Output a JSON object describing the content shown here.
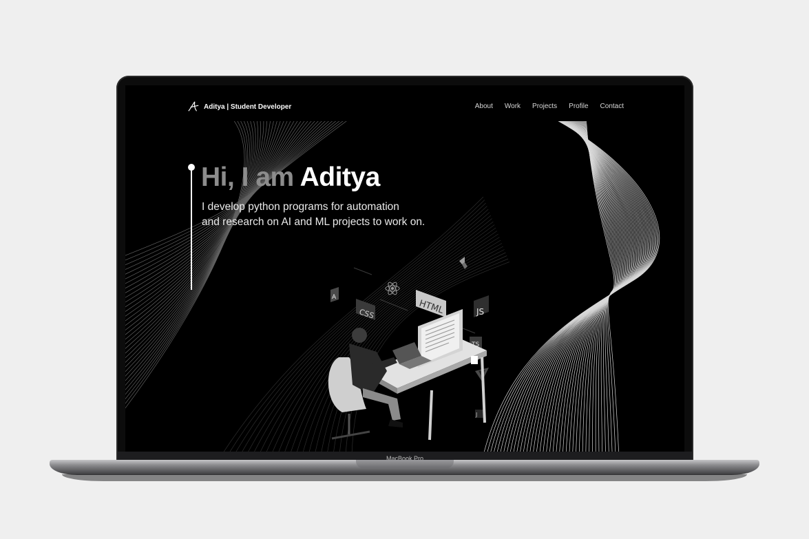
{
  "device": {
    "bezel_label": "MacBook Pro"
  },
  "nav": {
    "brand": "Aditya | Student Developer",
    "links": [
      "About",
      "Work",
      "Projects",
      "Profile",
      "Contact"
    ]
  },
  "hero": {
    "greeting": "Hi, I am",
    "name": "Aditya",
    "subtitle_line1": "I develop python programs for automation",
    "subtitle_line2": "and research on AI and ML projects to work on."
  },
  "illustration": {
    "tags": [
      "CSS",
      "HTML",
      "JS",
      "TS",
      "A"
    ],
    "icons": [
      "angular-icon",
      "react-icon",
      "flutter-icon",
      "vue-icon",
      "jest-icon"
    ]
  },
  "colors": {
    "page_bg": "#efefef",
    "screen_bg": "#000000",
    "accent": "#ffffff",
    "muted": "#8c8c8c"
  }
}
